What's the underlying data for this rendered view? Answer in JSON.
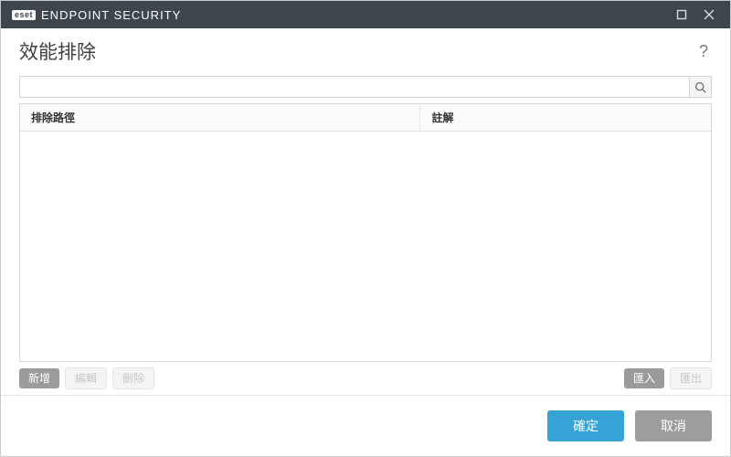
{
  "titlebar": {
    "brand_badge": "eset",
    "brand_text": "ENDPOINT SECURITY"
  },
  "header": {
    "title": "效能排除",
    "help": "?"
  },
  "search": {
    "value": "",
    "placeholder": ""
  },
  "table": {
    "columns": {
      "path": "排除路徑",
      "note": "註解"
    },
    "rows": []
  },
  "toolbar": {
    "add": "新增",
    "edit": "編輯",
    "delete": "刪除",
    "import": "匯入",
    "export": "匯出"
  },
  "footer": {
    "ok": "確定",
    "cancel": "取消"
  }
}
